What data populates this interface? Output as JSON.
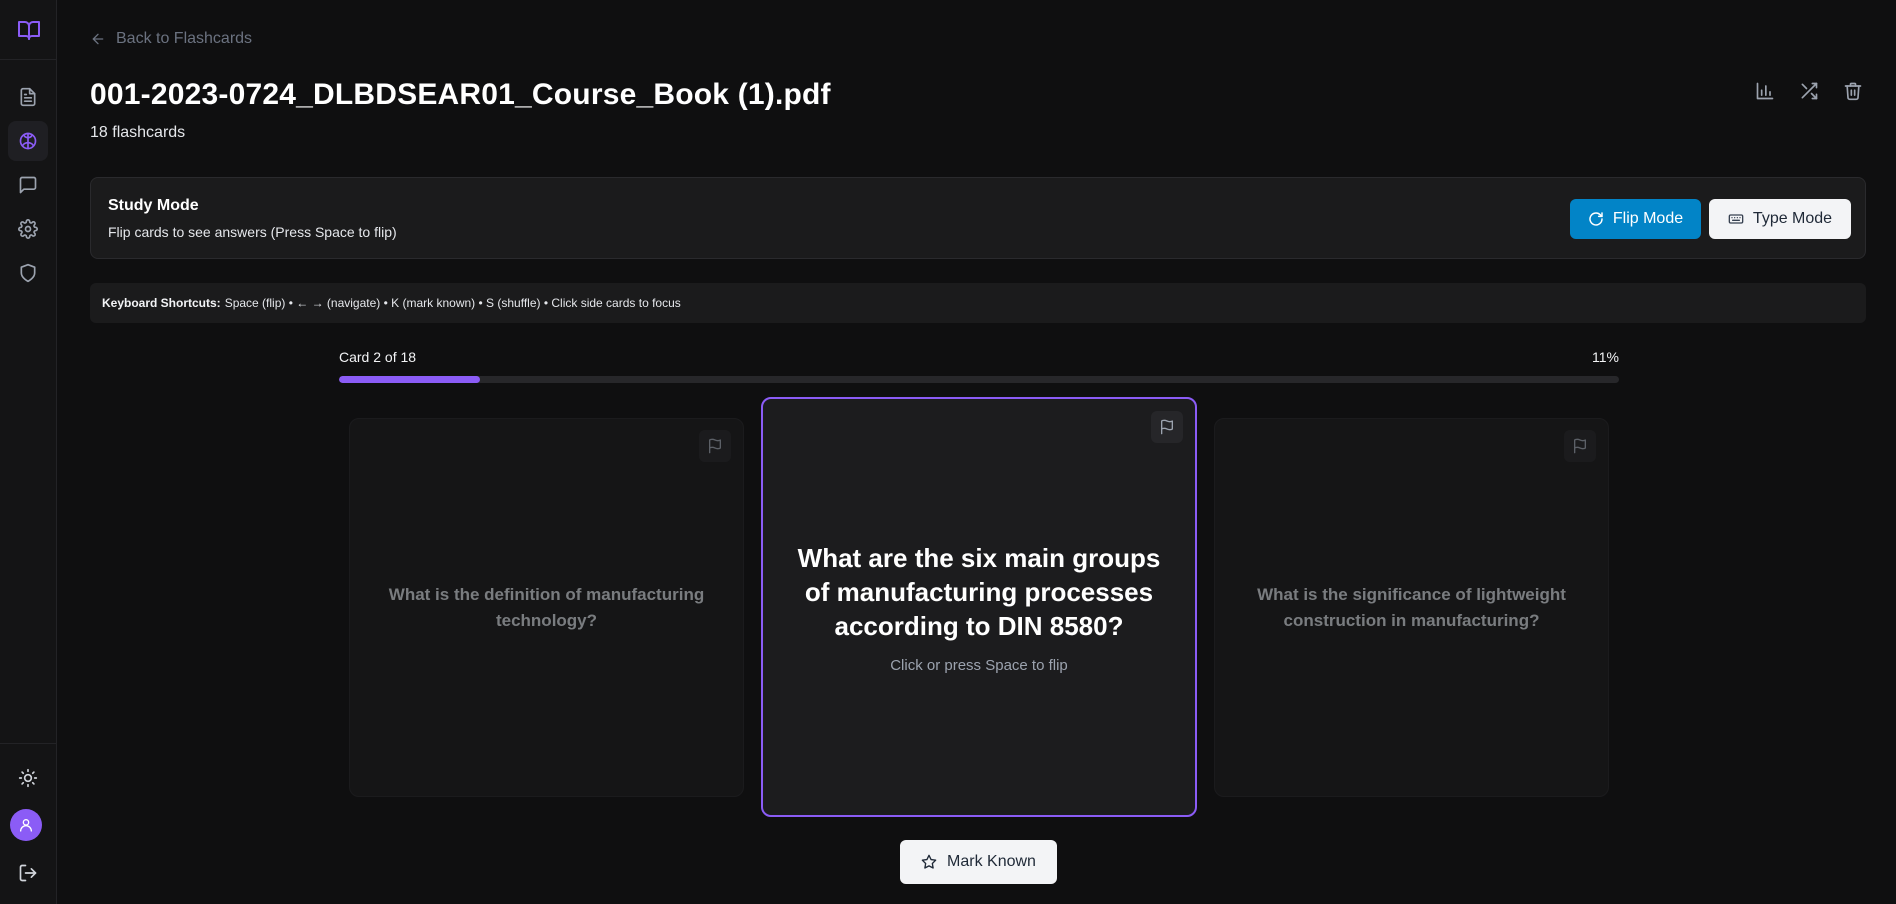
{
  "sidebar": {
    "logo": "book-open-icon",
    "items": [
      {
        "icon": "file-text-icon",
        "active": false
      },
      {
        "icon": "brain-icon",
        "active": true
      },
      {
        "icon": "message-square-icon",
        "active": false
      },
      {
        "icon": "settings-icon",
        "active": false
      },
      {
        "icon": "shield-icon",
        "active": false
      }
    ],
    "bottom": [
      "sun-icon",
      "user-avatar",
      "logout-icon"
    ]
  },
  "header": {
    "back_label": "Back to Flashcards",
    "title": "001-2023-0724_DLBDSEAR01_Course_Book (1).pdf",
    "subtitle": "18 flashcards",
    "actions": [
      "bar-chart-icon",
      "shuffle-icon",
      "trash-icon"
    ]
  },
  "study": {
    "title": "Study Mode",
    "description": "Flip cards to see answers (Press Space to flip)",
    "flip_label": "Flip Mode",
    "type_label": "Type Mode"
  },
  "shortcuts": {
    "label": "Keyboard Shortcuts:",
    "text": "Space (flip) • ← → (navigate) • K (mark known) • S (shuffle) • Click side cards to focus"
  },
  "progress": {
    "label": "Card 2 of 18",
    "percent_label": "11%",
    "fraction": 0.11
  },
  "cards": {
    "prev_question": "What is the definition of manufacturing technology?",
    "current_question": "What are the six main groups of manufacturing processes according to DIN 8580?",
    "current_hint": "Click or press Space to flip",
    "next_question": "What is the significance of lightweight construction in manufacturing?"
  },
  "mark_known_label": "Mark Known",
  "colors": {
    "accent": "#8b5cf6",
    "flip_button": "#0284c7",
    "background": "#0f0f10"
  }
}
